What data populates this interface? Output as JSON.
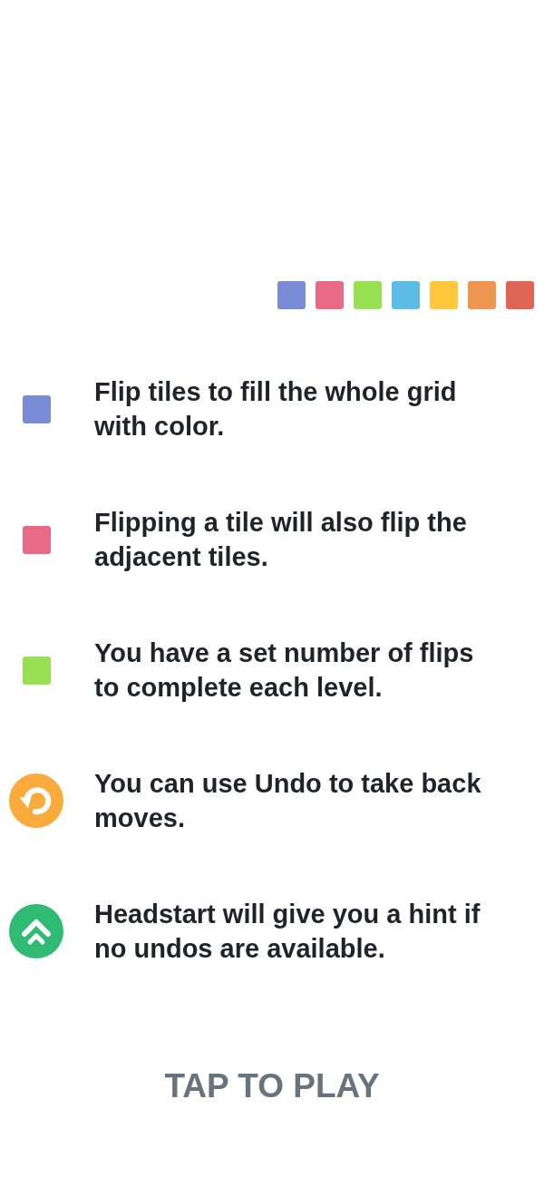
{
  "palette": [
    {
      "color": "#7b8cd6"
    },
    {
      "color": "#e86a86"
    },
    {
      "color": "#97e052"
    },
    {
      "color": "#5bbde4"
    },
    {
      "color": "#fec73c"
    },
    {
      "color": "#ee9550"
    },
    {
      "color": "#df6654"
    }
  ],
  "rules": [
    {
      "kind": "tile",
      "color": "#7b8cd6",
      "text": "Flip tiles to fill the whole grid with color."
    },
    {
      "kind": "tile",
      "color": "#e86a86",
      "text": "Flipping a tile will also flip the adjacent tiles."
    },
    {
      "kind": "tile",
      "color": "#97e052",
      "text": "You have a set number of flips to complete each level."
    },
    {
      "kind": "undo",
      "text": "You can use Undo to take back moves."
    },
    {
      "kind": "headstart",
      "text": "Headstart will give you a hint if no undos are available."
    }
  ],
  "play_button": {
    "label": "TAP TO PLAY"
  }
}
